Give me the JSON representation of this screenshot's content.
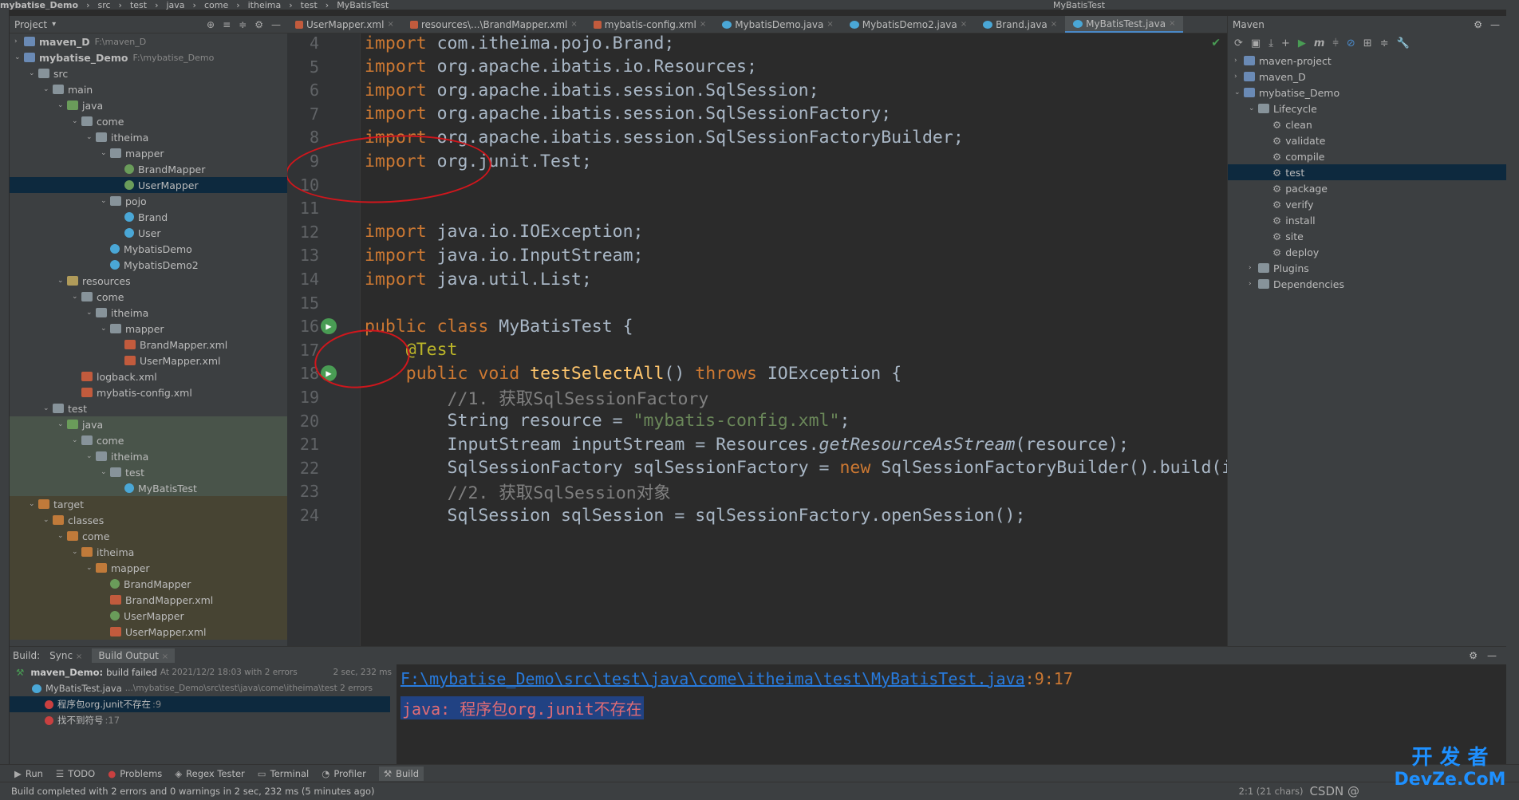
{
  "titlebar": {
    "crumbs": [
      "mybatise_Demo",
      "src",
      "test",
      "java",
      "come",
      "itheima",
      "test",
      "MyBatisTest"
    ],
    "run_config": "MyBatisTest"
  },
  "project": {
    "header": "Project",
    "items": [
      {
        "label": "maven_D",
        "sub": "F:\\maven_D",
        "indent": 0,
        "arrow": "›",
        "icon": "f-mod"
      },
      {
        "label": "mybatise_Demo",
        "sub": "F:\\mybatise_Demo",
        "indent": 0,
        "arrow": "⌄",
        "icon": "f-mod"
      },
      {
        "label": "src",
        "indent": 1,
        "arrow": "⌄",
        "icon": "f-folder"
      },
      {
        "label": "main",
        "indent": 2,
        "arrow": "⌄",
        "icon": "f-folder"
      },
      {
        "label": "java",
        "indent": 3,
        "arrow": "⌄",
        "icon": "f-src"
      },
      {
        "label": "come",
        "indent": 4,
        "arrow": "⌄",
        "icon": "f-folder"
      },
      {
        "label": "itheima",
        "indent": 5,
        "arrow": "⌄",
        "icon": "f-folder"
      },
      {
        "label": "mapper",
        "indent": 6,
        "arrow": "⌄",
        "icon": "f-folder"
      },
      {
        "label": "BrandMapper",
        "indent": 7,
        "arrow": "",
        "icon": "f-iface"
      },
      {
        "label": "UserMapper",
        "indent": 7,
        "arrow": "",
        "icon": "f-iface",
        "selected": true
      },
      {
        "label": "pojo",
        "indent": 6,
        "arrow": "⌄",
        "icon": "f-folder"
      },
      {
        "label": "Brand",
        "indent": 7,
        "arrow": "",
        "icon": "f-java"
      },
      {
        "label": "User",
        "indent": 7,
        "arrow": "",
        "icon": "f-java"
      },
      {
        "label": "MybatisDemo",
        "indent": 6,
        "arrow": "",
        "icon": "f-java"
      },
      {
        "label": "MybatisDemo2",
        "indent": 6,
        "arrow": "",
        "icon": "f-java"
      },
      {
        "label": "resources",
        "indent": 3,
        "arrow": "⌄",
        "icon": "f-res"
      },
      {
        "label": "come",
        "indent": 4,
        "arrow": "⌄",
        "icon": "f-folder"
      },
      {
        "label": "itheima",
        "indent": 5,
        "arrow": "⌄",
        "icon": "f-folder"
      },
      {
        "label": "mapper",
        "indent": 6,
        "arrow": "⌄",
        "icon": "f-folder"
      },
      {
        "label": "BrandMapper.xml",
        "indent": 7,
        "arrow": "",
        "icon": "f-xml"
      },
      {
        "label": "UserMapper.xml",
        "indent": 7,
        "arrow": "",
        "icon": "f-xml"
      },
      {
        "label": "logback.xml",
        "indent": 4,
        "arrow": "",
        "icon": "f-xml"
      },
      {
        "label": "mybatis-config.xml",
        "indent": 4,
        "arrow": "",
        "icon": "f-xml"
      },
      {
        "label": "test",
        "indent": 2,
        "arrow": "⌄",
        "icon": "f-folder"
      },
      {
        "label": "java",
        "indent": 3,
        "arrow": "⌄",
        "icon": "f-src",
        "green": true
      },
      {
        "label": "come",
        "indent": 4,
        "arrow": "⌄",
        "icon": "f-folder",
        "green": true
      },
      {
        "label": "itheima",
        "indent": 5,
        "arrow": "⌄",
        "icon": "f-folder",
        "green": true
      },
      {
        "label": "test",
        "indent": 6,
        "arrow": "⌄",
        "icon": "f-folder",
        "green": true
      },
      {
        "label": "MyBatisTest",
        "indent": 7,
        "arrow": "",
        "icon": "f-java",
        "green": true
      },
      {
        "label": "target",
        "indent": 1,
        "arrow": "⌄",
        "icon": "f-target",
        "target": true
      },
      {
        "label": "classes",
        "indent": 2,
        "arrow": "⌄",
        "icon": "f-target",
        "target": true
      },
      {
        "label": "come",
        "indent": 3,
        "arrow": "⌄",
        "icon": "f-target",
        "target": true
      },
      {
        "label": "itheima",
        "indent": 4,
        "arrow": "⌄",
        "icon": "f-target",
        "target": true
      },
      {
        "label": "mapper",
        "indent": 5,
        "arrow": "⌄",
        "icon": "f-target",
        "target": true
      },
      {
        "label": "BrandMapper",
        "indent": 6,
        "arrow": "",
        "icon": "f-iface",
        "target": true
      },
      {
        "label": "BrandMapper.xml",
        "indent": 6,
        "arrow": "",
        "icon": "f-xml",
        "target": true
      },
      {
        "label": "UserMapper",
        "indent": 6,
        "arrow": "",
        "icon": "f-iface",
        "target": true
      },
      {
        "label": "UserMapper.xml",
        "indent": 6,
        "arrow": "",
        "icon": "f-xml",
        "target": true
      }
    ]
  },
  "tabs": [
    {
      "label": "UserMapper.xml",
      "icon": "f-xml"
    },
    {
      "label": "resources\\...\\BrandMapper.xml",
      "icon": "f-xml"
    },
    {
      "label": "mybatis-config.xml",
      "icon": "f-xml"
    },
    {
      "label": "MybatisDemo.java",
      "icon": "f-java"
    },
    {
      "label": "MybatisDemo2.java",
      "icon": "f-java"
    },
    {
      "label": "Brand.java",
      "icon": "f-java"
    },
    {
      "label": "MyBatisTest.java",
      "icon": "f-java",
      "active": true
    }
  ],
  "editor": {
    "lines": [
      {
        "n": "4",
        "html": "<span class=\"kw\">import</span> com.itheima.pojo.Brand;"
      },
      {
        "n": "5",
        "html": "<span class=\"kw\">import</span> org.apache.ibatis.io.Resources;"
      },
      {
        "n": "6",
        "html": "<span class=\"kw\">import</span> org.apache.ibatis.session.SqlSession;"
      },
      {
        "n": "7",
        "html": "<span class=\"kw\">import</span> org.apache.ibatis.session.SqlSessionFactory;"
      },
      {
        "n": "8",
        "html": "<span class=\"kw\">import</span> org.apache.ibatis.session.SqlSessionFactoryBuilder;"
      },
      {
        "n": "9",
        "html": "<span class=\"kw\">import</span> org.junit.Test;"
      },
      {
        "n": "10",
        "html": ""
      },
      {
        "n": "11",
        "html": ""
      },
      {
        "n": "12",
        "html": "<span class=\"kw\">import</span> java.io.IOException;"
      },
      {
        "n": "13",
        "html": "<span class=\"kw\">import</span> java.io.InputStream;"
      },
      {
        "n": "14",
        "html": "<span class=\"kw\">import</span> java.util.List;"
      },
      {
        "n": "15",
        "html": ""
      },
      {
        "n": "16",
        "html": "<span class=\"kw\">public class</span> MyBatisTest {",
        "gicon": true
      },
      {
        "n": "17",
        "html": "    <span class=\"an\">@Test</span>"
      },
      {
        "n": "18",
        "html": "    <span class=\"kw\">public void</span> <span class=\"fn\">testSelectAll</span>() <span class=\"kw\">throws</span> IOException {",
        "gicon": true
      },
      {
        "n": "19",
        "html": "        <span class=\"cm\">//1. 获取SqlSessionFactory</span>"
      },
      {
        "n": "20",
        "html": "        String resource = <span class=\"st\">\"mybatis-config.xml\"</span>;"
      },
      {
        "n": "21",
        "html": "        InputStream inputStream = Resources.<span class=\"it\">getResourceAsStream</span>(resource);"
      },
      {
        "n": "22",
        "html": "        SqlSessionFactory sqlSessionFactory = <span class=\"kw\">new</span> SqlSessionFactoryBuilder().build(i"
      },
      {
        "n": "23",
        "html": "        <span class=\"cm\">//2. 获取SqlSession对象</span>"
      },
      {
        "n": "24",
        "html": "        SqlSession sqlSession = sqlSessionFactory.openSession();"
      }
    ]
  },
  "maven": {
    "header": "Maven",
    "items": [
      {
        "label": "maven-project",
        "indent": 0,
        "arrow": "›",
        "icon": "f-mod"
      },
      {
        "label": "maven_D",
        "indent": 0,
        "arrow": "›",
        "icon": "f-mod"
      },
      {
        "label": "mybatise_Demo",
        "indent": 0,
        "arrow": "⌄",
        "icon": "f-mod"
      },
      {
        "label": "Lifecycle",
        "indent": 1,
        "arrow": "⌄",
        "icon": "f-folder"
      },
      {
        "label": "clean",
        "indent": 2,
        "arrow": "",
        "gear": true
      },
      {
        "label": "validate",
        "indent": 2,
        "arrow": "",
        "gear": true
      },
      {
        "label": "compile",
        "indent": 2,
        "arrow": "",
        "gear": true
      },
      {
        "label": "test",
        "indent": 2,
        "arrow": "",
        "gear": true,
        "selected": true
      },
      {
        "label": "package",
        "indent": 2,
        "arrow": "",
        "gear": true
      },
      {
        "label": "verify",
        "indent": 2,
        "arrow": "",
        "gear": true
      },
      {
        "label": "install",
        "indent": 2,
        "arrow": "",
        "gear": true
      },
      {
        "label": "site",
        "indent": 2,
        "arrow": "",
        "gear": true
      },
      {
        "label": "deploy",
        "indent": 2,
        "arrow": "",
        "gear": true
      },
      {
        "label": "Plugins",
        "indent": 1,
        "arrow": "›",
        "icon": "f-folder"
      },
      {
        "label": "Dependencies",
        "indent": 1,
        "arrow": "›",
        "icon": "f-folder"
      }
    ]
  },
  "build": {
    "label": "Build:",
    "tab_sync": "Sync",
    "tab_output": "Build Output",
    "summary_title": "maven_Demo:",
    "summary_status": "build failed",
    "summary_time": "At 2021/12/2 18:03 with 2 errors",
    "summary_duration": "2 sec, 232 ms",
    "file_name": "MyBatisTest.java",
    "file_path": "...\\mybatise_Demo\\src\\test\\java\\come\\itheima\\test 2 errors",
    "error1": "程序包org.junit不存在",
    "error1_line": ":9",
    "error2": "找不到符号",
    "error2_line": ":17",
    "out_path": "F:\\mybatise_Demo\\src\\test\\java\\come\\itheima\\test\\MyBatisTest.java",
    "out_pos": ":9:17",
    "out_msg": "java: 程序包org.junit不存在"
  },
  "bottom_tabs": [
    "Run",
    "TODO",
    "Problems",
    "Regex Tester",
    "Terminal",
    "Profiler",
    "Build"
  ],
  "status": {
    "message": "Build completed with 2 errors and 0 warnings in 2 sec, 232 ms (5 minutes ago)",
    "right": "2:1 (21 chars)"
  },
  "watermark": {
    "csdn": "CSDN @",
    "brand_cn": "开 发 者",
    "brand_en": "DevZe.CoM"
  }
}
